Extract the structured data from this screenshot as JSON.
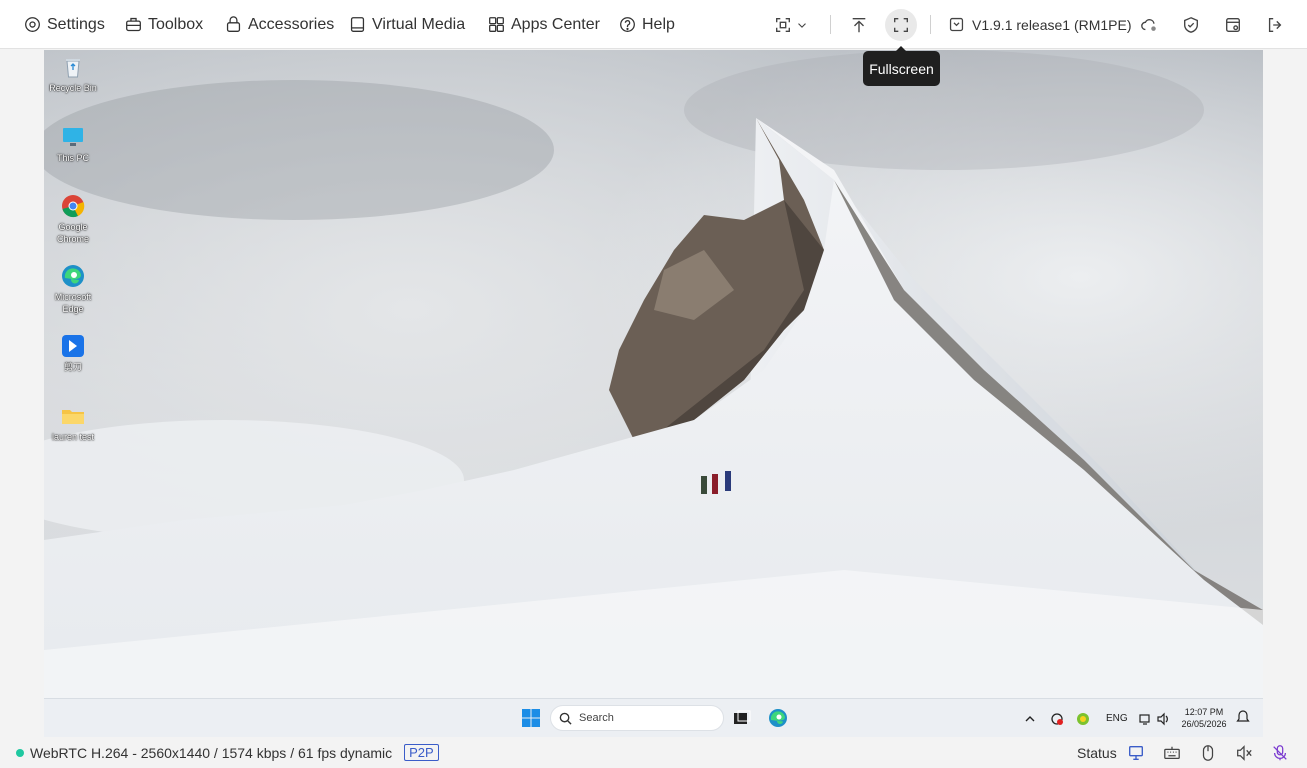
{
  "toolbar": {
    "menus": [
      "Settings",
      "Toolbox",
      "Accessories",
      "Virtual Media",
      "Apps Center",
      "Help"
    ],
    "version": "V1.9.1 release1 (RM1PE)",
    "tooltip": "Fullscreen"
  },
  "desktop": {
    "icons": [
      {
        "label": "Recycle Bin",
        "icon": "recycle-bin-icon"
      },
      {
        "label": "This PC",
        "icon": "this-pc-icon"
      },
      {
        "label": "Google Chrome",
        "icon": "chrome-icon"
      },
      {
        "label": "Microsoft Edge",
        "icon": "edge-icon"
      },
      {
        "label": "剪刀",
        "icon": "app-shortcut-icon"
      },
      {
        "label": "lauren test",
        "icon": "folder-icon"
      }
    ]
  },
  "taskbar": {
    "search_placeholder": "Search",
    "language": "ENG",
    "time": "12:07 PM",
    "date": "26/05/2026"
  },
  "status": {
    "stream_info": "WebRTC H.264 - 2560x1440 / 1574 kbps / 61 fps dynamic",
    "connection_badge": "P2P",
    "status_label": "Status"
  },
  "colors": {
    "accent": "#3a5cc8",
    "status_dot": "#1fc8a0",
    "tooltip_bg": "#1f1f1f"
  }
}
